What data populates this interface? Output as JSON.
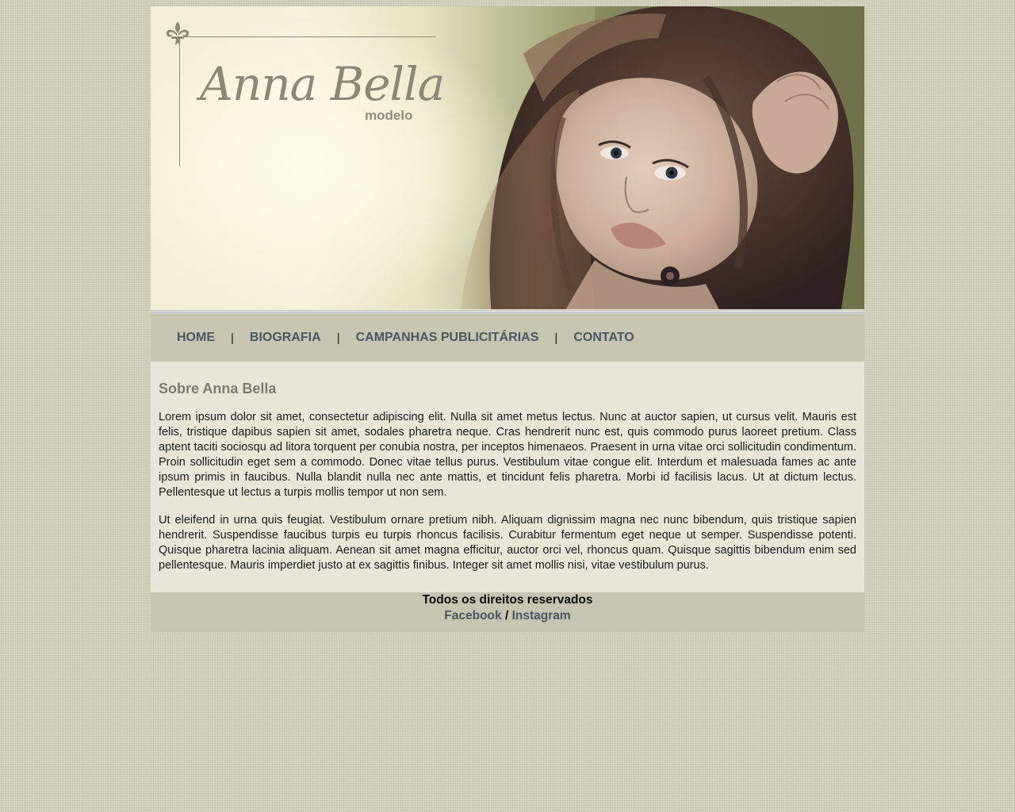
{
  "header": {
    "brand_name": "Anna Bella",
    "brand_subtitle": "modelo"
  },
  "nav": {
    "items": [
      {
        "label": "HOME"
      },
      {
        "label": "BIOGRAFIA"
      },
      {
        "label": "CAMPANHAS PUBLICITÁRIAS"
      },
      {
        "label": "CONTATO"
      }
    ],
    "separator": "|"
  },
  "main": {
    "heading": "Sobre Anna Bella",
    "paragraphs": [
      "Lorem ipsum dolor sit amet, consectetur adipiscing elit. Nulla sit amet metus lectus. Nunc at auctor sapien, ut cursus velit. Mauris est felis, tristique dapibus sapien sit amet, sodales pharetra neque. Cras hendrerit nunc est, quis commodo purus laoreet pretium. Class aptent taciti sociosqu ad litora torquent per conubia nostra, per inceptos himenaeos. Praesent in urna vitae orci sollicitudin condimentum. Proin sollicitudin eget sem a commodo. Donec vitae tellus purus. Vestibulum vitae congue elit. Interdum et malesuada fames ac ante ipsum primis in faucibus. Nulla blandit nulla nec ante mattis, et tincidunt felis pharetra. Morbi id facilisis lacus. Ut at dictum lectus. Pellentesque ut lectus a turpis mollis tempor ut non sem.",
      "Ut eleifend in urna quis feugiat. Vestibulum ornare pretium nibh. Aliquam dignissim magna nec nunc bibendum, quis tristique sapien hendrerit. Suspendisse faucibus turpis eu turpis rhoncus facilisis. Curabitur fermentum eget neque ut semper. Suspendisse potenti. Quisque pharetra lacinia aliquam. Aenean sit amet magna efficitur, auctor orci vel, rhoncus quam. Quisque sagittis bibendum enim sed pellentesque. Mauris imperdiet justo at ex sagittis finibus. Integer sit amet mollis nisi, vitae vestibulum purus."
    ]
  },
  "footer": {
    "rights": "Todos os direitos reservados",
    "facebook": "Facebook",
    "slash": "/",
    "instagram": "Instagram"
  },
  "colors": {
    "page_background": "#d3d3bf",
    "nav_background": "#c6c5b1",
    "content_background": "#e7e6d8",
    "link_color": "#4c5563",
    "heading_color": "#7c7b72"
  },
  "icons": {
    "banner_ornament": "fleur-de-lis-icon"
  }
}
